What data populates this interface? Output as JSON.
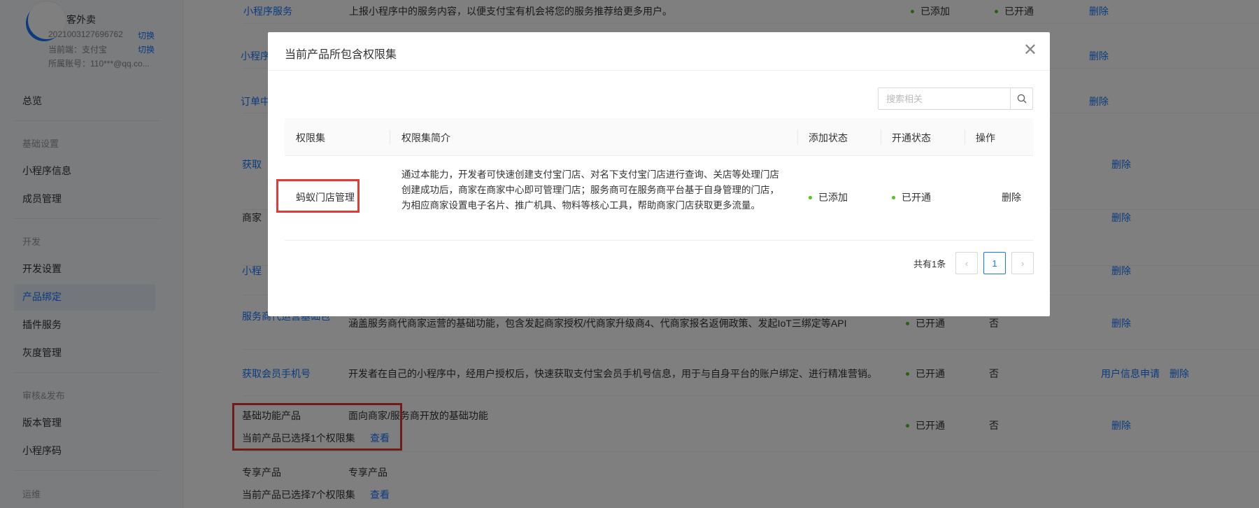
{
  "account": {
    "name": "客外卖",
    "id": "2021003127696762",
    "switch_label": "切换",
    "env": "当前端：支付宝",
    "env_switch": "切换",
    "owner": "所属账号：110***@qq.co..."
  },
  "sidebar": {
    "overview": "总览",
    "group_basic": "基础设置",
    "mini_info": "小程序信息",
    "members": "成员管理",
    "group_dev": "开发",
    "dev_settings": "开发设置",
    "product_binding": "产品绑定",
    "plugin_service": "插件服务",
    "gray_management": "灰度管理",
    "group_review": "审核&发布",
    "version_management": "版本管理",
    "mini_code": "小程序码",
    "group_ops": "运维"
  },
  "background_table": {
    "rows": [
      {
        "name": "小程序服务",
        "desc": "上报小程序中的服务内容，以便支付宝有机会将您的服务推荐给更多用户。",
        "add": "已添加",
        "open": "已开通",
        "op": "删除"
      },
      {
        "name": "小程序",
        "op": "删除"
      },
      {
        "name": "订单中",
        "op": "删除"
      },
      {
        "name": "获取",
        "op": "删除"
      },
      {
        "name": "商家",
        "op": "删除"
      },
      {
        "name": "小程",
        "op": "删除"
      },
      {
        "name": "服务商代运营基础包",
        "desc": "涵盖服务商代商家运营的基础功能，包含发起商家授权/代商家升级商4、代商家报名返佣政策、发起IoT三绑定等API",
        "open": "已开通",
        "flag": "否",
        "op": "删除"
      },
      {
        "name": "获取会员手机号",
        "desc": "开发者在自己的小程序中，经用户授权后，快速获取支付宝会员手机号信息，用于与自身平台的账户绑定、进行精准营销。",
        "open": "已开通",
        "flag": "否",
        "op": "删除",
        "extra_op": "用户信息申请"
      },
      {
        "name": "基础功能产品",
        "desc": "面向商家/服务商开放的基础功能",
        "selected": "当前产品已选择1个权限集",
        "view": "查看",
        "open": "已开通",
        "flag": "否",
        "op": "删除"
      },
      {
        "name": "专享产品",
        "desc": "专享产品",
        "selected": "当前产品已选择7个权限集",
        "view": "查看"
      }
    ]
  },
  "modal": {
    "title": "当前产品所包含权限集",
    "search_placeholder": "搜索相关",
    "columns": [
      "权限集",
      "权限集简介",
      "添加状态",
      "开通状态",
      "操作"
    ],
    "rows": [
      {
        "name": "蚂蚁门店管理",
        "desc": "通过本能力，开发者可快速创建支付宝门店、对名下支付宝门店进行查询、关店等处理门店创建成功后，商家在商家中心即可管理门店；服务商可在服务商平台基于自身管理的门店，为相应商家设置电子名片、推广机具、物料等核心工具，帮助商家门店获取更多流量。",
        "add_status": "已添加",
        "open_status": "已开通",
        "action": "删除"
      }
    ],
    "total": "共有1条",
    "prev": "‹",
    "page": "1",
    "next": "›"
  },
  "colors": {
    "link": "#1677ff",
    "success": "#52c41a",
    "highlight": "#e53935"
  }
}
